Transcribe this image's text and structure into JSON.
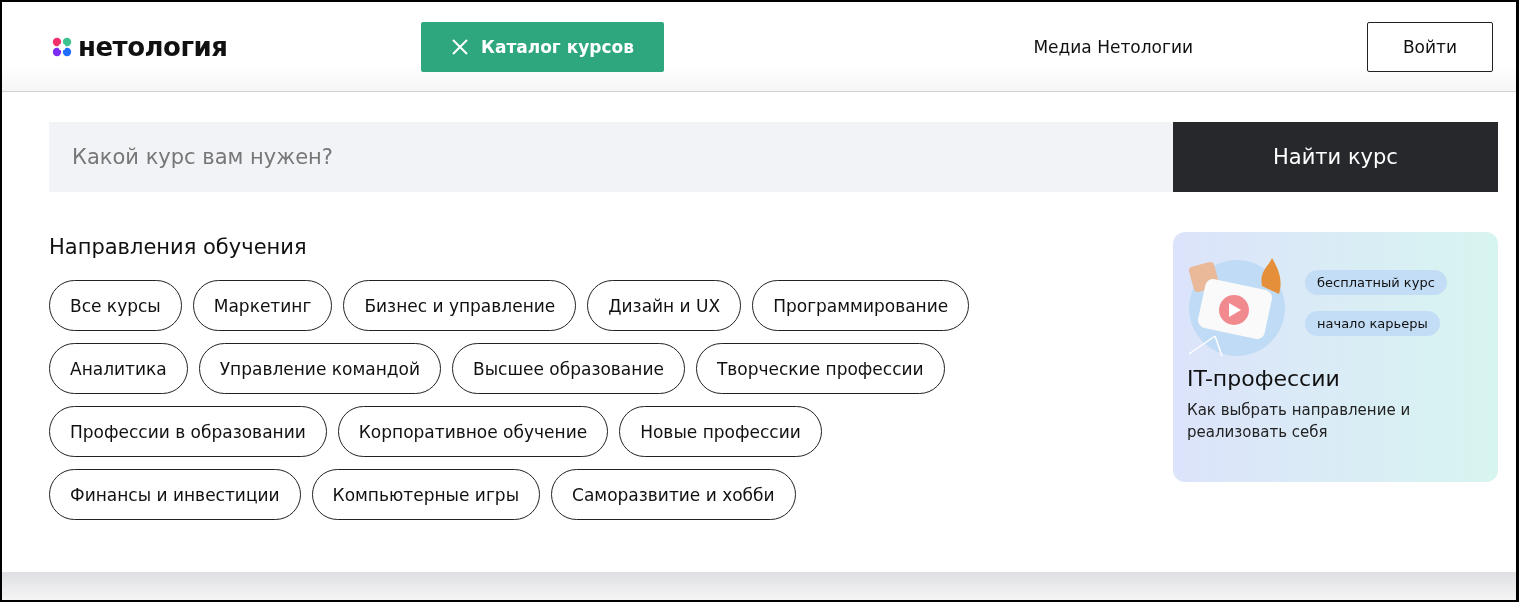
{
  "header": {
    "logo_text": "нетология",
    "catalog_button": "Каталог курсов",
    "nav_link": "Медиа Нетологии",
    "login_button": "Войти"
  },
  "search": {
    "placeholder": "Какой курс вам нужен?",
    "button": "Найти курс"
  },
  "directions": {
    "title": "Направления обучения",
    "chips": [
      [
        "Все курсы",
        "Маркетинг",
        "Бизнес и управление",
        "Дизайн и UX",
        "Программирование"
      ],
      [
        "Аналитика",
        "Управление командой",
        "Высшее образование",
        "Творческие профессии"
      ],
      [
        "Профессии в образовании",
        "Корпоративное обучение",
        "Новые профессии"
      ],
      [
        "Финансы и инвестиции",
        "Компьютерные игры",
        "Саморазвитие и хобби"
      ]
    ]
  },
  "promo": {
    "tags": [
      "бесплатный курс",
      "начало карьеры"
    ],
    "title": "IT-профессии",
    "text": "Как выбрать направление и реализовать себя"
  }
}
